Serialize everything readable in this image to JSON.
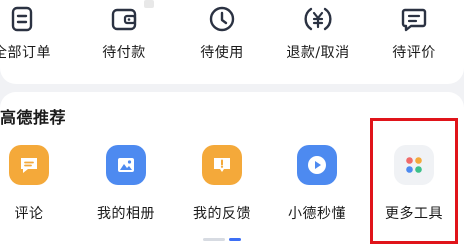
{
  "orders": {
    "items": [
      {
        "label": "全部订单",
        "icon": "all-orders-icon"
      },
      {
        "label": "待付款",
        "icon": "wallet-icon"
      },
      {
        "label": "待使用",
        "icon": "clock-icon"
      },
      {
        "label": "退款/取消",
        "icon": "refund-icon"
      },
      {
        "label": "待评价",
        "icon": "review-icon"
      }
    ]
  },
  "recommend": {
    "title": "高德推荐",
    "items": [
      {
        "label": "评论",
        "icon": "comment-icon",
        "color": "#f4a93a"
      },
      {
        "label": "我的相册",
        "icon": "album-icon",
        "color": "#4d8af0"
      },
      {
        "label": "我的反馈",
        "icon": "feedback-icon",
        "color": "#f4a93a"
      },
      {
        "label": "小德秒懂",
        "icon": "play-icon",
        "color": "#4d8af0"
      },
      {
        "label": "更多工具",
        "icon": "more-tools-icon",
        "color": "#f0f2f5"
      }
    ]
  },
  "colors": {
    "accent": "#3d6ff5",
    "highlight": "#e0141a",
    "icon_stroke": "#2b3242"
  },
  "pager": {
    "pages": 2,
    "active": 2
  }
}
